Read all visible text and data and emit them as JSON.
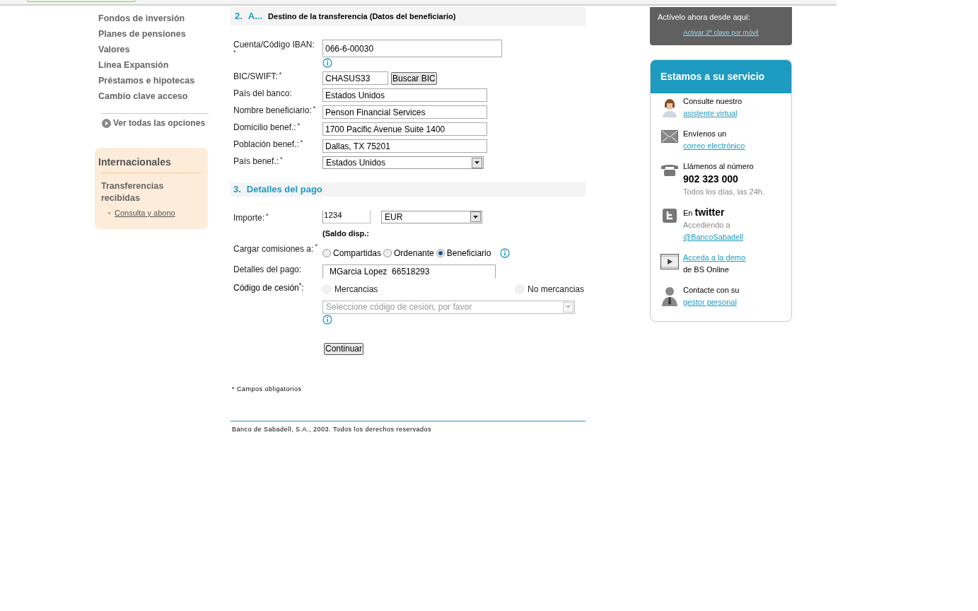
{
  "nav": {
    "items": [
      "Fondos de inversión",
      "Planes de pensiones",
      "Valores",
      "Línea Expansión",
      "Préstamos e hipotecas",
      "Cambio clave acceso"
    ],
    "more": "Ver todas las opciones"
  },
  "intl": {
    "title": "Internacionales",
    "subtitle": "Transferencias recibidas",
    "links": [
      "Consulta y abono"
    ]
  },
  "section2": {
    "number": "2.",
    "step": "A...",
    "title": "Destino de la transferencia (Datos del beneficiario)",
    "fields": [
      {
        "kind": "text",
        "label": "Cuenta/Código IBAN:",
        "mark": "*",
        "mark_below": true,
        "value": "066-6-00030",
        "wide": true,
        "info": true
      },
      {
        "kind": "button",
        "label": "BIC/SWIFT:",
        "mark": "*",
        "value": "CHASUS33",
        "button": "Buscar BIC"
      },
      {
        "kind": "text",
        "label": "País del banco:",
        "value": "Estados Unidos"
      },
      {
        "kind": "text",
        "label": "Nombre beneficiario:",
        "mark": "*",
        "value": "Penson Financial Services"
      },
      {
        "kind": "text",
        "label": "Domicilio benef.:",
        "mark": "*",
        "value": "1700 Pacific Avenue Suite 1400"
      },
      {
        "kind": "text",
        "label": "Población benef.:",
        "mark": "*",
        "value": "Dallas, TX 75201"
      },
      {
        "kind": "select",
        "label": "País benef.:",
        "mark": "*",
        "value": "Estados Unidos"
      }
    ]
  },
  "section3": {
    "number": "3.",
    "title": "Detalles del pago",
    "amount": {
      "label": "Importe:",
      "mark": "*",
      "value": "1234",
      "currency": "EUR",
      "balance": "(Saldo disp.:"
    },
    "fees": {
      "label": "Cargar comisiones a:",
      "mark": "*",
      "options": [
        {
          "label": "Compartidas",
          "selected": false
        },
        {
          "label": "Ordenante",
          "selected": false
        },
        {
          "label": "Beneficiario",
          "selected": true
        }
      ]
    },
    "details": {
      "label": "Detalles del pago:",
      "value": "MGarcia Lopez  66518293"
    },
    "code": {
      "label": "Código de cesión",
      "mark": "*",
      "colon": ":",
      "options": [
        {
          "label": "Mercancias",
          "selected": false,
          "disabled": true
        },
        {
          "label": "No mercancias",
          "selected": false,
          "disabled": true
        }
      ],
      "placeholder": "Seleccione código de cesión, por favor",
      "disabled": true
    },
    "submit": "Continuar"
  },
  "footnote": "* Campos obligatorios",
  "footer": "Banco de Sabadell, S.A., 2003. Todos los derechos reservados",
  "promo": {
    "text": "Actívelo ahora desde aquí:",
    "link": "Activar 2ª clave por móvil"
  },
  "service": {
    "title": "Estamos a su servicio",
    "items": [
      {
        "kind": "assistant",
        "lines": [
          {
            "kind": "text",
            "text": "Consulte nuestro"
          },
          {
            "kind": "link",
            "text": "asistente virtual"
          }
        ]
      },
      {
        "kind": "mail",
        "lines": [
          {
            "kind": "text",
            "text": "Envíenos un"
          },
          {
            "kind": "link",
            "text": "correo electrónico"
          }
        ]
      },
      {
        "kind": "phone",
        "lines": [
          {
            "kind": "text",
            "text": "Llámenos al número"
          },
          {
            "kind": "big",
            "text": "902 323 000"
          },
          {
            "kind": "muted",
            "text": "Todos los días, las 24h."
          }
        ]
      },
      {
        "kind": "twitter",
        "lines": [
          {
            "kind": "text",
            "text": "En **twitter**"
          },
          {
            "kind": "muted",
            "text": "Accediendo a"
          },
          {
            "kind": "link",
            "text": "@BancoSabadell"
          }
        ]
      },
      {
        "kind": "video",
        "lines": [
          {
            "kind": "link",
            "text": "Acceda a la demo"
          },
          {
            "kind": "text",
            "text": "de BS Online"
          }
        ]
      },
      {
        "kind": "person",
        "lines": [
          {
            "kind": "text",
            "text": "Contacte con su"
          },
          {
            "kind": "link",
            "text": "gestor personal"
          }
        ]
      }
    ]
  }
}
